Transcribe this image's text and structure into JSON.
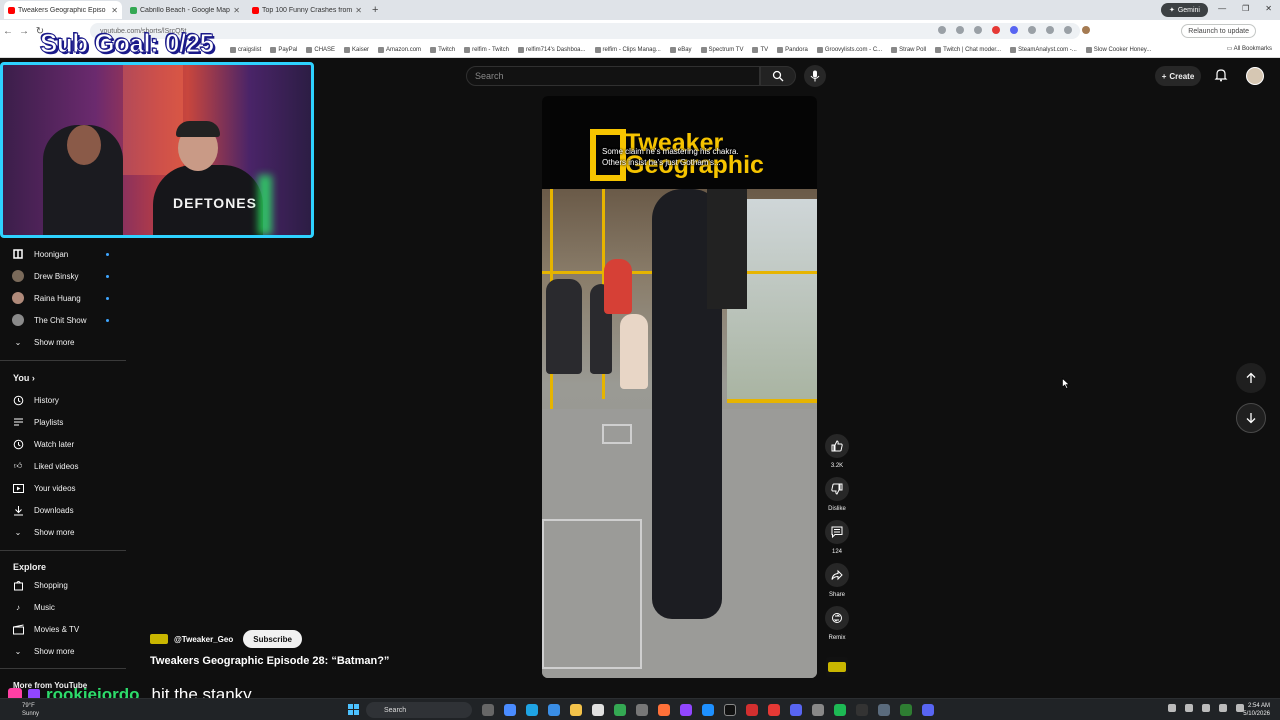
{
  "browser": {
    "tabs": [
      {
        "label": "Tweakers Geographic Episo",
        "fav_color": "#ff0000",
        "active": true
      },
      {
        "label": "Cabrillo Beach - Google Maps",
        "fav_color": "#34a853",
        "active": false
      },
      {
        "label": "Top 100 Funny Crashes from Ro",
        "fav_color": "#ff0000",
        "active": false
      }
    ],
    "gemini_label": "Gemini",
    "url": "youtube.com/shorts/lSrcQ5t",
    "relaunch_label": "Relaunch to update",
    "bookmarks": [
      "craigslist",
      "PayPal",
      "CHASE",
      "Kaiser",
      "Amazon.com",
      "Twitch",
      "relfim - Twitch",
      "relfim714's Dashboa...",
      "relfim - Clips Manag...",
      "eBay",
      "Spectrum TV",
      "TV",
      "Pandora",
      "Groovylists.com - C...",
      "Straw Poll",
      "Twitch | Chat moder...",
      "SteamAnalyst.com -...",
      "Slow Cooker Honey..."
    ],
    "all_bookmarks_label": "All Bookmarks"
  },
  "overlay": {
    "sub_goal": "Sub Goal: 0/25",
    "webcam_shirt": "DEFTONES",
    "chat_user": "rookiejordo",
    "chat_message": "hit the stanky"
  },
  "youtube": {
    "search_placeholder": "Search",
    "create_label": "Create",
    "sidebar": {
      "subscriptions": [
        {
          "label": "Hoonigan",
          "color": "#ffffff"
        },
        {
          "label": "Drew Binsky",
          "color": "#7a6a5a"
        },
        {
          "label": "Raina Huang",
          "color": "#b08a7a"
        },
        {
          "label": "The Chit Show",
          "color": "#8a8a8a"
        }
      ],
      "show_more_1": "Show more",
      "you_label": "You",
      "you_items": [
        "History",
        "Playlists",
        "Watch later",
        "Liked videos",
        "Your videos",
        "Downloads"
      ],
      "show_more_2": "Show more",
      "explore_label": "Explore",
      "explore_items": [
        "Shopping",
        "Music",
        "Movies & TV"
      ],
      "show_more_3": "Show more",
      "more_from_label": "More from YouTube"
    },
    "video": {
      "logo_text": "Tweaker\nGeographic",
      "caption_line1": "Some claim he's mastering his chakra.",
      "caption_line2": "Others insist he's just Gotham's...",
      "channel_handle": "@Tweaker_Geo",
      "subscribe_label": "Subscribe",
      "title": "Tweakers Geographic Episode 28: “Batman?”"
    },
    "actions": {
      "likes": "3.2K",
      "dislike_label": "Dislike",
      "comments": "124",
      "share_label": "Share",
      "remix_label": "Remix"
    }
  },
  "taskbar": {
    "weather_temp": "79°F",
    "weather_desc": "Sunny",
    "search_label": "Search",
    "time": "2:54 AM",
    "date": "5/10/2026"
  }
}
